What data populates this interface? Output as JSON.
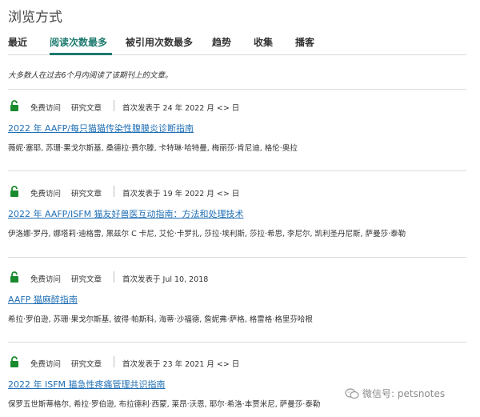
{
  "page": {
    "title": "浏览方式"
  },
  "tabs": [
    {
      "label": "最近",
      "active": false
    },
    {
      "label": "阅读次数最多",
      "active": true
    },
    {
      "label": "被引用次数最多",
      "active": false
    },
    {
      "label": "趋势",
      "active": false
    },
    {
      "label": "收集",
      "active": false
    },
    {
      "label": "播客",
      "active": false
    }
  ],
  "note": "大多数人在过去6个月内阅读了该期刊上的文章。",
  "articles": [
    {
      "access": "免费访问",
      "type": "研究文章",
      "date": "首次发表于 24 年 2022 月 <> 日",
      "title": "2022 年 AAFP/每只猫猫传染性腹膜炎诊断指南",
      "authors": "薇妮·塞耶, 苏珊·果戈尔斯基, 桑德拉·费尔滕, 卡特琳·哈特曼, 梅丽莎·肯尼迪, 格伦·奥拉"
    },
    {
      "access": "免费访问",
      "type": "研究文章",
      "date": "首次发表于 19 年 2022 月 <> 日",
      "title": "2022 年 AAFP/ISFM 猫友好兽医互动指南：方法和处理技术",
      "authors": "伊洛娜·罗丹, 娜塔莉·迪格雷, 黑兹尔 C 卡尼, 艾伦·卡罗扎, 莎拉·埃利斯, 莎拉·希思, 李尼尔, 凯利圣丹尼斯, 萨曼莎·泰勒"
    },
    {
      "access": "免费访问",
      "type": "研究文章",
      "date": "首次发表于 Jul 10, 2018",
      "title": "AAFP 猫麻醉指南",
      "authors": "希拉·罗伯逊, 苏珊·果戈尔斯基, 彼得·帕斯科, 海蒂·沙福德, 詹妮弗·萨格, 格雷格·格里芬哈根"
    },
    {
      "access": "免费访问",
      "type": "研究文章",
      "date": "首次发表于 23 年 2021 月 <> 日",
      "title": "2022 年 ISFM 猫急性疼痛管理共识指南",
      "authors": "保罗五世斯蒂格尔, 希拉·罗伯逊, 布拉德利·西蒙, 莱昂·沃恩, 耶尔·希洛·本贾米尼, 萨曼莎·泰勒"
    }
  ],
  "watermark": "微信号: petsnotes",
  "colors": {
    "accent": "#1e7a6e",
    "link": "#1f6fb5",
    "lock": "#1a8a2e"
  }
}
